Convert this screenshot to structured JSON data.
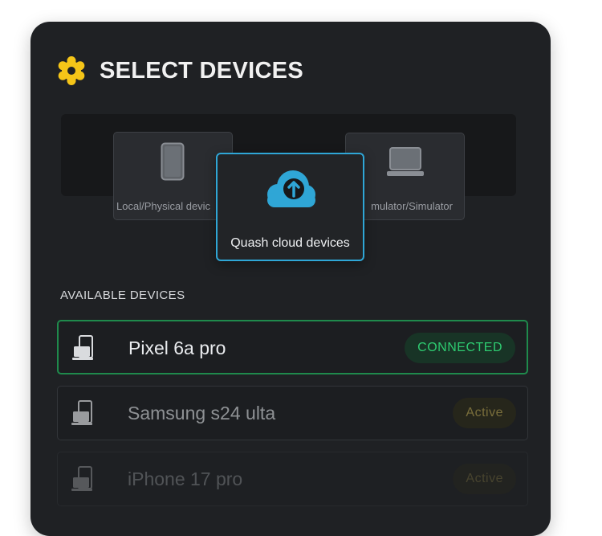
{
  "header": {
    "title": "SELECT DEVICES",
    "icon": "gear-icon",
    "icon_color": "#f5c518"
  },
  "selector": {
    "options": [
      {
        "label": "Local/Physical devic",
        "icon": "phone-icon"
      },
      {
        "label": "Quash cloud devices",
        "icon": "cloud-upload-icon",
        "selected": true,
        "accent": "#2fa6d6"
      },
      {
        "label": "mulator/Simulator",
        "icon": "laptop-icon"
      }
    ]
  },
  "devices": {
    "section_label": "AVAILABLE DEVICES",
    "items": [
      {
        "name": "Pixel 6a pro",
        "status": "CONNECTED",
        "status_color": "#2ecc71",
        "icon": "devices-icon"
      },
      {
        "name": "Samsung s24 ulta",
        "status": "Active",
        "status_color": "#9c8c45",
        "icon": "devices-icon"
      },
      {
        "name": "iPhone 17 pro",
        "status": "Active",
        "status_color": "#9c8c45",
        "icon": "devices-icon"
      }
    ]
  }
}
